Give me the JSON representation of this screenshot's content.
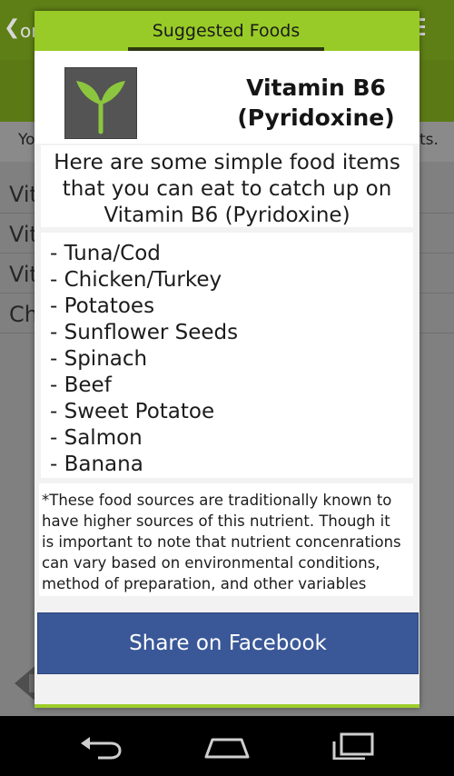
{
  "background_app": {
    "tab_left_label": "oms",
    "note_left": "Yo",
    "note_right": "ts.",
    "rows": [
      "Vit",
      "Vit",
      "Vit",
      "Ch"
    ]
  },
  "dialog": {
    "tab_label": "Suggested Foods",
    "title_line1": "Vitamin B6",
    "title_line2": "(Pyridoxine)",
    "intro_line1": "Here are some simple food items",
    "intro_line2": "that you can eat to catch up on",
    "intro_line3": "Vitamin B6 (Pyridoxine)",
    "foods": [
      "- Tuna/Cod",
      "- Chicken/Turkey",
      "- Potatoes",
      "- Sunflower Seeds",
      "- Spinach",
      "- Beef",
      "- Sweet Potatoe",
      "- Salmon",
      "- Banana"
    ],
    "disclaimer_lines": [
      "*These food sources are traditionally known to",
      "have higher sources of this nutrient. Though it",
      "is important to note that nutrient concenrations",
      "can vary based on environmental conditions,",
      "method of preparation, and other variables"
    ],
    "share_button_label": "Share on Facebook"
  },
  "colors": {
    "accent_green": "#98cb27",
    "facebook_blue": "#3a5898",
    "dialog_background": "#f2f2f2"
  },
  "icons": {
    "logo": "sprout-logo-icon",
    "nav_back": "back-icon",
    "nav_home": "home-icon",
    "nav_recents": "recents-icon"
  }
}
